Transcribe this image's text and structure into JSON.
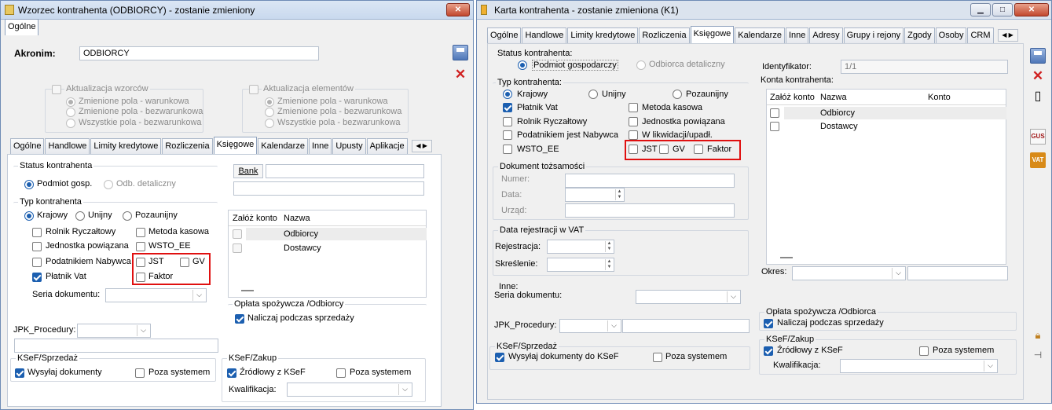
{
  "left": {
    "title": "Wzorzec kontrahenta (ODBIORCY) - zostanie zmieniony",
    "top_tab": "Ogólne",
    "akronim_label": "Akronim:",
    "akronim_value": "ODBIORCY",
    "akt_wzorcow": "Aktualizacja wzorców",
    "akt_elementow": "Aktualizacja elementów",
    "opt_warunkowa": "Zmienione pola - warunkowa",
    "opt_bezwarunkowa": "Zmienione pola - bezwarunkowa",
    "opt_wszystkie": "Wszystkie pola - bezwarunkowa",
    "tabs": [
      "Ogólne",
      "Handlowe",
      "Limity kredytowe",
      "Rozliczenia",
      "Księgowe",
      "Kalendarze",
      "Inne",
      "Upusty",
      "Aplikacje"
    ],
    "status_kontrahenta": "Status kontrahenta",
    "podmiot_gosp": "Podmiot gosp.",
    "odb_detaliczny": "Odb. detaliczny",
    "typ_kontrahenta": "Typ kontrahenta",
    "krajowy": "Krajowy",
    "unijny": "Unijny",
    "pozaunijny": "Pozaunijny",
    "rolnik": "Rolnik Ryczałtowy",
    "metoda": "Metoda kasowa",
    "jednostka": "Jednostka powiązana",
    "wsto": "WSTO_EE",
    "podatnik": "Podatnikiem Nabywca",
    "jst": "JST",
    "gv": "GV",
    "faktor": "Faktor",
    "platnik": "Płatnik Vat",
    "seria": "Seria dokumentu:",
    "bank": "Bank",
    "zaloz_konto": "Załóż konto",
    "nazwa": "Nazwa",
    "rows": [
      "Odbiorcy",
      "Dostawcy"
    ],
    "oplata": "Opłata spożywcza /Odbiorcy",
    "naliczaj": "Naliczaj podczas sprzedaży",
    "jpk": "JPK_Procedury:",
    "ksef_sprzedaz": "KSeF/Sprzedaż",
    "wysylaj": "Wysyłaj dokumenty",
    "poza": "Poza systemem",
    "ksef_zakup": "KSeF/Zakup",
    "zrodlowy": "Źródłowy z KSeF",
    "kwalifikacja": "Kwalifikacja:"
  },
  "right": {
    "title": "Karta kontrahenta - zostanie zmieniona (K1)",
    "tabs": [
      "Ogólne",
      "Handlowe",
      "Limity kredytowe",
      "Rozliczenia",
      "Księgowe",
      "Kalendarze",
      "Inne",
      "Adresy",
      "Grupy i rejony",
      "Zgody",
      "Osoby",
      "CRM"
    ],
    "status_kontrahenta": "Status kontrahenta:",
    "podmiot": "Podmiot gospodarczy",
    "odbiorca_det": "Odbiorca detaliczny",
    "typ_kontrahenta": "Typ kontrahenta:",
    "krajowy": "Krajowy",
    "unijny": "Unijny",
    "pozaunijny": "Pozaunijny",
    "platnik": "Płatnik Vat",
    "metoda": "Metoda kasowa",
    "rolnik": "Rolnik Ryczałtowy",
    "jednostka": "Jednostka powiązana",
    "podatnik": "Podatnikiem jest Nabywca",
    "likwidacja": "W likwidacji/upadł.",
    "wsto": "WSTO_EE",
    "jst": "JST",
    "gv": "GV",
    "faktor": "Faktor",
    "dok_tozsamosci": "Dokument tożsamości",
    "numer": "Numer:",
    "data": "Data:",
    "urzad": "Urząd:",
    "data_rej": "Data rejestracji w VAT",
    "rejestracja": "Rejestracja:",
    "skreslenie": "Skreślenie:",
    "inne": "Inne:",
    "seria": "Seria dokumentu:",
    "jpk": "JPK_Procedury:",
    "ksef_sprzedaz": "KSeF/Sprzedaż",
    "wysylaj": "Wysyłaj dokumenty do KSeF",
    "poza": "Poza systemem",
    "identyfikator_label": "Identyfikator:",
    "identyfikator": "1/1",
    "konta": "Konta kontrahenta:",
    "zaloz_konto": "Załóż konto",
    "nazwa": "Nazwa",
    "konto": "Konto",
    "rows": [
      "Odbiorcy",
      "Dostawcy"
    ],
    "okres": "Okres:",
    "oplata": "Opłata spożywcza /Odbiorca",
    "naliczaj": "Naliczaj podczas sprzedaży",
    "ksef_zakup": "KSeF/Zakup",
    "zrodlowy": "Źródłowy z KSeF",
    "kwalifikacja": "Kwalifikacja:",
    "gus": "GUS",
    "vat": "VAT"
  }
}
